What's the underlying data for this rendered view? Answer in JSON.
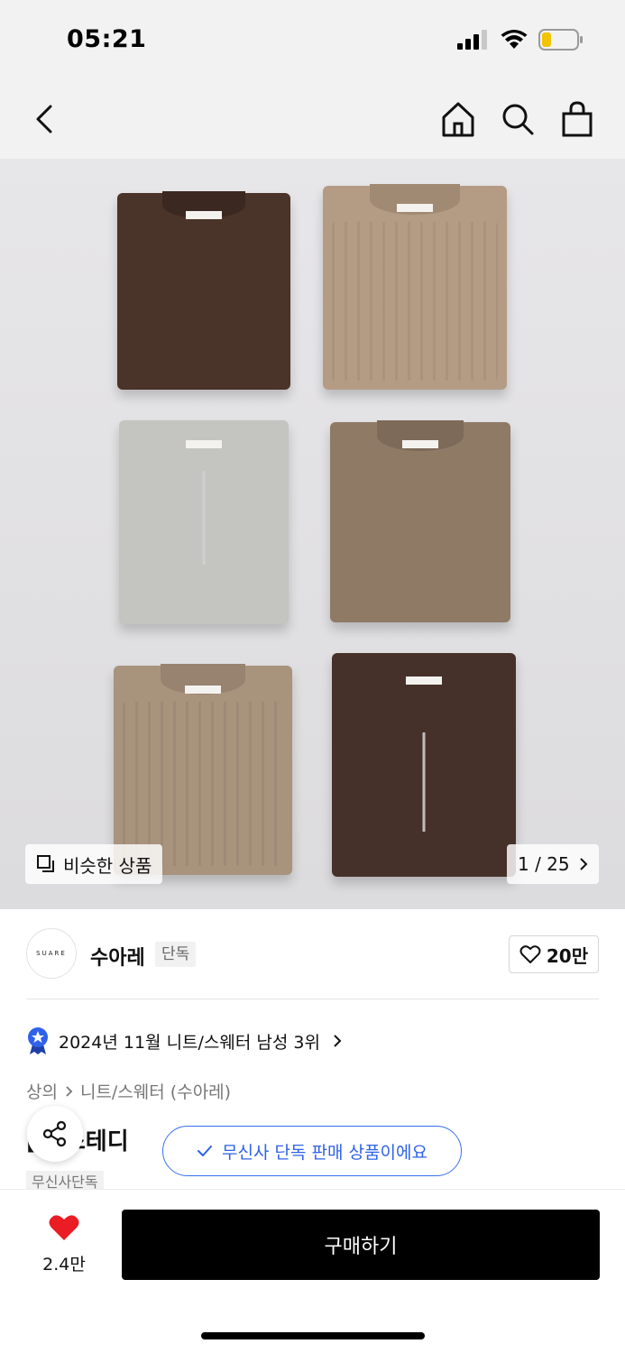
{
  "status_bar": {
    "time": "05:21"
  },
  "nav": {
    "back": "back-icon",
    "home": "home-icon",
    "search": "search-icon",
    "cart": "shopping-bag-icon"
  },
  "gallery": {
    "similar_label": "비슷한 상품",
    "counter": "1 / 25",
    "brand_tag_text": "SUARE",
    "colors": {
      "dark_brown": "#4a3328",
      "beige_cable": "#b49c84",
      "light_gray": "#c4c4c0",
      "taupe": "#8f7a66",
      "beige_cable_2": "#a8937d",
      "dark_brown_2": "#46312a"
    }
  },
  "brand": {
    "logo_text": "SUARE",
    "name": "수아레",
    "badge": "단독",
    "like_count": "20만"
  },
  "ranking": {
    "text": "2024년 11월 니트/스웨터 남성 3위"
  },
  "breadcrumb": {
    "level1": "상의",
    "level2": "니트/스웨터 (수아레)"
  },
  "product": {
    "title_visible": "[    ] 스테디",
    "toast": "무신사 단독 판매 상품이에요",
    "tag_chip": "무신사단독"
  },
  "bottom": {
    "like_count": "2.4만",
    "buy_label": "구매하기"
  },
  "accent": {
    "blue": "#2f62e8",
    "heart_red": "#ea1c24"
  }
}
